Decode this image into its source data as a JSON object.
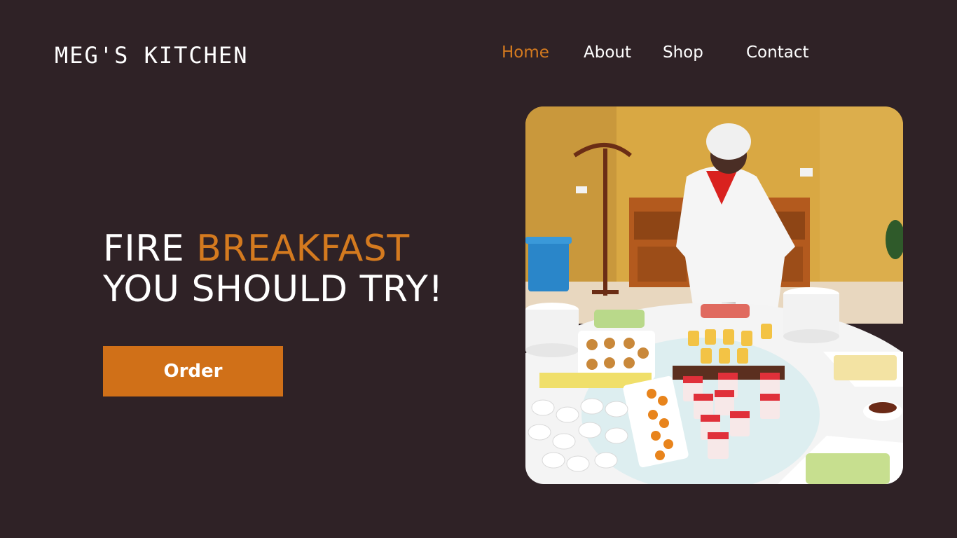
{
  "brand": {
    "name": "MEG'S KITCHEN"
  },
  "nav": {
    "items": [
      {
        "label": "Home",
        "active": true
      },
      {
        "label": "About",
        "active": false
      },
      {
        "label": "Shop",
        "active": false
      },
      {
        "label": "Contact",
        "active": false
      }
    ]
  },
  "hero": {
    "headline_prefix": "FIRE ",
    "headline_accent": "BREAKFAST",
    "headline_line2": "YOU SHOULD TRY!",
    "cta_label": "Order",
    "image_name": "chef-breakfast-buffet-photo"
  },
  "colors": {
    "background": "#2f2226",
    "accent": "#d47a1f",
    "button": "#d07018",
    "text": "#ffffff"
  }
}
